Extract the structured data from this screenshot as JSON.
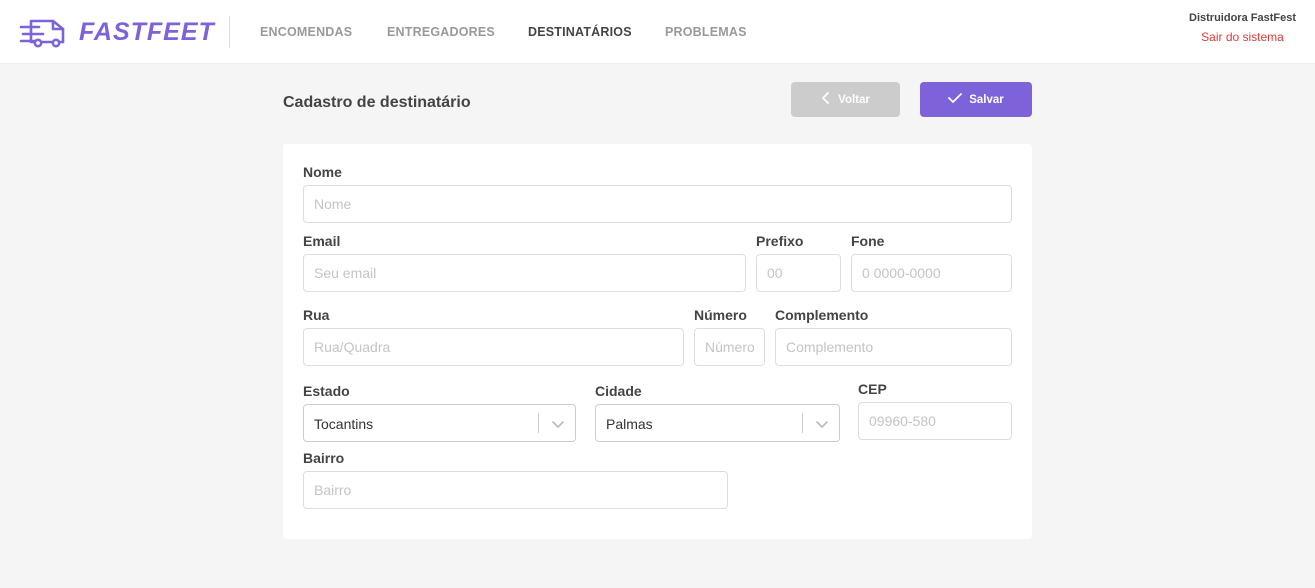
{
  "header": {
    "logo_text": "FASTFEET",
    "nav": [
      {
        "label": "ENCOMENDAS"
      },
      {
        "label": "ENTREGADORES"
      },
      {
        "label": "DESTINATÁRIOS",
        "active": true
      },
      {
        "label": "PROBLEMAS"
      }
    ],
    "user_name": "Distruidora FastFest",
    "exit_label": "Sair do sistema"
  },
  "page": {
    "title": "Cadastro de destinatário",
    "back_label": "Voltar",
    "save_label": "Salvar"
  },
  "form": {
    "nome": {
      "label": "Nome",
      "placeholder": "Nome",
      "value": ""
    },
    "email": {
      "label": "Email",
      "placeholder": "Seu email",
      "value": ""
    },
    "prefixo": {
      "label": "Prefixo",
      "placeholder": "00",
      "value": ""
    },
    "fone": {
      "label": "Fone",
      "placeholder": "0 0000-0000",
      "value": ""
    },
    "rua": {
      "label": "Rua",
      "placeholder": "Rua/Quadra",
      "value": ""
    },
    "numero": {
      "label": "Número",
      "placeholder": "Número",
      "value": ""
    },
    "complemento": {
      "label": "Complemento",
      "placeholder": "Complemento",
      "value": ""
    },
    "estado": {
      "label": "Estado",
      "value": "Tocantins"
    },
    "cidade": {
      "label": "Cidade",
      "value": "Palmas"
    },
    "cep": {
      "label": "CEP",
      "placeholder": "09960-580",
      "value": ""
    },
    "bairro": {
      "label": "Bairro",
      "placeholder": "Bairro",
      "value": ""
    }
  },
  "colors": {
    "brand": "#7d62da",
    "exit": "#de3b3b",
    "back_button": "#cccccc",
    "background": "#f5f5f5"
  },
  "icons": {
    "logo": "truck-icon",
    "back": "chevron-left-icon",
    "save": "check-icon",
    "select": "chevron-down-icon"
  }
}
